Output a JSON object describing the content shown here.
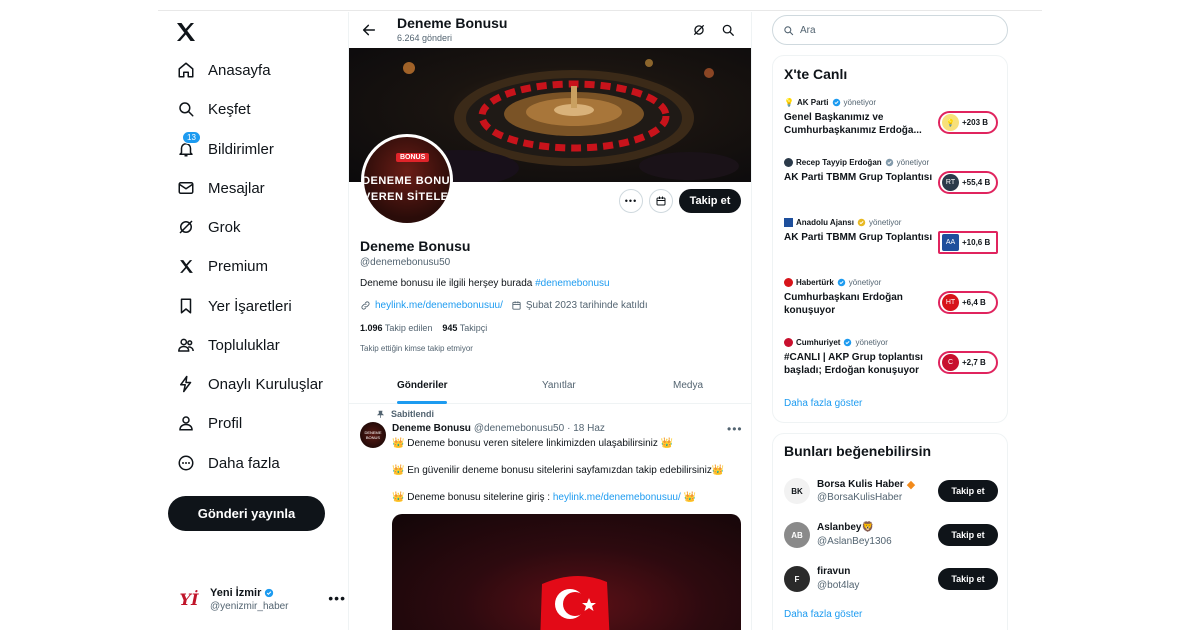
{
  "sidebar": {
    "nav": [
      {
        "label": "Anasayfa",
        "icon": "home-icon"
      },
      {
        "label": "Keşfet",
        "icon": "search-icon"
      },
      {
        "label": "Bildirimler",
        "icon": "bell-icon",
        "badge": "13"
      },
      {
        "label": "Mesajlar",
        "icon": "mail-icon"
      },
      {
        "label": "Grok",
        "icon": "grok-icon"
      },
      {
        "label": "Premium",
        "icon": "x-logo-icon"
      },
      {
        "label": "Yer İşaretleri",
        "icon": "bookmark-icon"
      },
      {
        "label": "Topluluklar",
        "icon": "people-icon"
      },
      {
        "label": "Onaylı Kuruluşlar",
        "icon": "lightning-icon"
      },
      {
        "label": "Profil",
        "icon": "person-icon"
      },
      {
        "label": "Daha fazla",
        "icon": "more-circle-icon"
      }
    ],
    "post_button": "Gönderi yayınla",
    "account": {
      "name": "Yeni İzmir",
      "handle": "@yenizmir_haber",
      "avatar_text": "Yİ"
    }
  },
  "header": {
    "title": "Deneme Bonusu",
    "subtitle": "6.264 gönderi"
  },
  "profile": {
    "avatar_badge": "BONUS",
    "avatar_line1": "DENEME BONUS",
    "avatar_line2": "VEREN SİTELER",
    "follow_label": "Takip et",
    "name": "Deneme Bonusu",
    "handle": "@denemebonusu50",
    "bio_text": "Deneme bonusu ile ilgili herşey burada ",
    "bio_hashtag": "#denemebonusu",
    "website": "heylink.me/denemebonusuu/",
    "joined": "Şubat 2023 tarihinde katıldı",
    "following_count": "1.096",
    "following_label": "Takip edilen",
    "followers_count": "945",
    "followers_label": "Takipçi",
    "note": "Takip ettiğin kimse takip etmiyor"
  },
  "tabs": [
    "Gönderiler",
    "Yanıtlar",
    "Medya"
  ],
  "tweet": {
    "pinned_label": "Sabitlendi",
    "author": "Deneme Bonusu",
    "handle": "@denemebonusu50",
    "date": "· 18 Haz",
    "line1": "👑 Deneme bonusu veren sitelere linkimizden ulaşabilirsiniz 👑",
    "line2": "👑 En güvenilir deneme bonusu sitelerini sayfamızdan takip edebilirsiniz👑",
    "line3_text": "👑 Deneme bonusu sitelerine giriş : ",
    "line3_link": "heylink.me/denemebonusuu/",
    "line3_end": " 👑"
  },
  "search": {
    "placeholder": "Ara"
  },
  "live": {
    "title": "X'te Canlı",
    "items": [
      {
        "source": "AK Parti",
        "status": "yönetiyor",
        "title": "Genel Başkanımız ve Cumhurbaşkanımız Erdoğa...",
        "count": "+203 B",
        "color": "#f5a623",
        "avatar": "💡"
      },
      {
        "source": "Recep Tayyip Erdoğan",
        "status": "yönetiyor",
        "title": "AK Parti TBMM Grup Toplantısı",
        "count": "+55,4 B",
        "color": "#2b3a4a",
        "avatar": "RT"
      },
      {
        "source": "Anadolu Ajansı",
        "status": "yönetiyor",
        "title": "AK Parti TBMM Grup Toplantısı",
        "count": "+10,6 B",
        "color": "#1e4f9c",
        "avatar": "AA"
      },
      {
        "source": "Habertürk",
        "status": "yönetiyor",
        "title": "Cumhurbaşkanı Erdoğan konuşuyor",
        "count": "+6,4 B",
        "color": "#d7141a",
        "avatar": "HT"
      },
      {
        "source": "Cumhuriyet",
        "status": "yönetiyor",
        "title": "#CANLI | AKP Grup toplantısı başladı; Erdoğan konuşuyor",
        "count": "+2,7 B",
        "color": "#c8102e",
        "avatar": "C"
      }
    ],
    "more": "Daha fazla göster"
  },
  "suggestions": {
    "title": "Bunları beğenebilirsin",
    "items": [
      {
        "name": "Borsa Kulis Haber",
        "handle": "@BorsaKulisHaber",
        "button": "Takip et",
        "avatar": "BK"
      },
      {
        "name": "Aslanbey🦁",
        "handle": "@AslanBey1306",
        "button": "Takip et",
        "avatar": "AB"
      },
      {
        "name": "firavun",
        "handle": "@bot4lay",
        "button": "Takip et",
        "avatar": "F"
      }
    ],
    "more": "Daha fazla göster"
  }
}
